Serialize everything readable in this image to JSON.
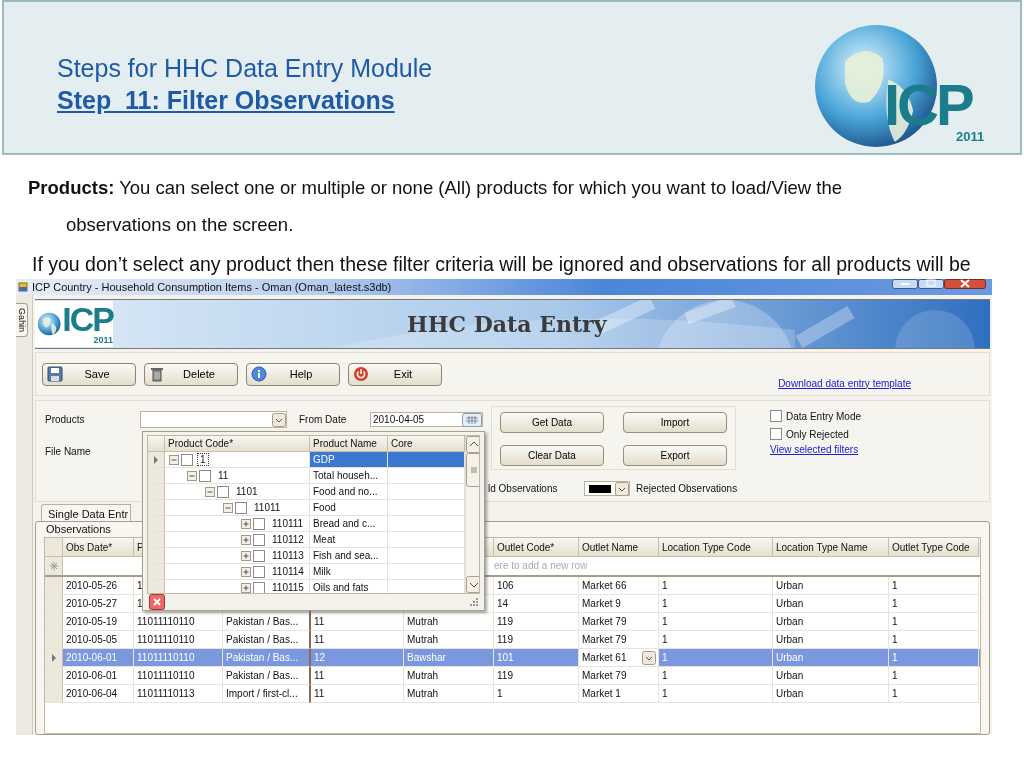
{
  "slide": {
    "title": "Steps for HHC Data Entry Module",
    "subtitle": "Step  11: Filter Observations",
    "logo": {
      "letters": "ICP",
      "year": "2011"
    }
  },
  "paragraphs": [
    {
      "kind": "hanging",
      "text": "**Products:** You can select one or multiple or none (All) products for which you want to load/View the observations on the screen."
    },
    {
      "kind": "plain",
      "text": "If you don’t select any product then these filter criteria will be ignored and observations for all products will be"
    }
  ],
  "window": {
    "title": "ICP Country - Household Consumption Items - Oman (Oman_latest.s3db)",
    "side_tab": "Gahin",
    "banner": {
      "logo": {
        "letters": "ICP",
        "year": "2011"
      },
      "title": "HHC Data Entry"
    },
    "toolbar": [
      {
        "label": "Save"
      },
      {
        "label": "Delete"
      },
      {
        "label": "Help"
      },
      {
        "label": "Exit"
      }
    ],
    "template_link": "Download data entry template",
    "filters": {
      "products_label": "Products",
      "from_date_label": "From Date",
      "from_date": "2010-04-05",
      "file_name_label": "File Name",
      "actions": [
        "Get Data",
        "Import",
        "Clear Data",
        "Export"
      ],
      "options": [
        {
          "label": "Data Entry Mode",
          "checked": false
        },
        {
          "label": "Only Rejected",
          "checked": false
        }
      ],
      "filters_link": "View selected filters",
      "valid_label": "ld Observations",
      "rejected_label": "Rejected Observations"
    },
    "tabs": [
      {
        "label": "Single Data Entr",
        "selected": true
      }
    ],
    "observations": {
      "title": "Observations",
      "columns": [
        {
          "label": "Obs Date*"
        },
        {
          "label": "P"
        },
        {},
        {},
        {},
        {
          "label": "Outlet Code*"
        },
        {
          "label": "Outlet Name"
        },
        {
          "label": "Location Type Code"
        },
        {
          "label": "Location Type Name"
        },
        {
          "label": "Outlet Type Code"
        }
      ],
      "new_row_hint": "ere to add a new row",
      "rows": [
        {
          "selected": false,
          "editing": false,
          "cells": [
            "2010-05-26",
            "1",
            null,
            null,
            null,
            "106",
            "Market 66",
            "1",
            "Urban",
            "1"
          ]
        },
        {
          "selected": false,
          "editing": false,
          "cells": [
            "2010-05-27",
            "1",
            null,
            null,
            null,
            "14",
            "Market 9",
            "1",
            "Urban",
            "1"
          ]
        },
        {
          "selected": false,
          "editing": false,
          "cells": [
            "2010-05-19",
            "11011110110",
            "Pakistan / Bas...",
            "11",
            "Mutrah",
            "119",
            "Market 79",
            "1",
            "Urban",
            "1"
          ]
        },
        {
          "selected": false,
          "editing": false,
          "cells": [
            "2010-05-05",
            "11011110110",
            "Pakistan / Bas...",
            "11",
            "Mutrah",
            "119",
            "Market 79",
            "1",
            "Urban",
            "1"
          ]
        },
        {
          "selected": true,
          "editing": true,
          "cells": [
            "2010-06-01",
            "11011110110",
            "Pakistan / Bas...",
            "12",
            "Bawshar",
            "101",
            "Market 61",
            "1",
            "Urban",
            "1"
          ]
        },
        {
          "selected": false,
          "editing": false,
          "cells": [
            "2010-06-01",
            "11011110110",
            "Pakistan / Bas...",
            "11",
            "Mutrah",
            "119",
            "Market 79",
            "1",
            "Urban",
            "1"
          ]
        },
        {
          "selected": false,
          "editing": false,
          "cells": [
            "2010-06-04",
            "11011110113",
            "Import / first-cl...",
            "11",
            "Mutrah",
            "1",
            "Market 1",
            "1",
            "Urban",
            "1"
          ]
        }
      ]
    },
    "product_dropdown": {
      "columns": [
        "Product Code*",
        "Product Name",
        "Core"
      ],
      "tree": [
        {
          "code": "1",
          "name": "GDP",
          "expanded": true,
          "checked": false,
          "selected": true,
          "children": [
            {
              "code": "11",
              "name": "Total househ...",
              "expanded": true,
              "checked": false,
              "selected": false,
              "children": [
                {
                  "code": "1101",
                  "name": "Food and no...",
                  "expanded": true,
                  "checked": false,
                  "selected": false,
                  "children": [
                    {
                      "code": "11011",
                      "name": "Food",
                      "expanded": true,
                      "checked": false,
                      "selected": false,
                      "children": [
                        {
                          "code": "110111",
                          "name": "Bread and c...",
                          "expanded": false,
                          "checked": false,
                          "selected": false
                        },
                        {
                          "code": "110112",
                          "name": "Meat",
                          "expanded": false,
                          "checked": false,
                          "selected": false
                        },
                        {
                          "code": "110113",
                          "name": "Fish and sea...",
                          "expanded": false,
                          "checked": false,
                          "selected": false
                        },
                        {
                          "code": "110114",
                          "name": "Milk",
                          "expanded": false,
                          "checked": false,
                          "selected": false
                        },
                        {
                          "code": "110115",
                          "name": "Oils and fats",
                          "expanded": false,
                          "checked": false,
                          "selected": false
                        }
                      ]
                    }
                  ]
                }
              ]
            }
          ]
        }
      ]
    }
  }
}
